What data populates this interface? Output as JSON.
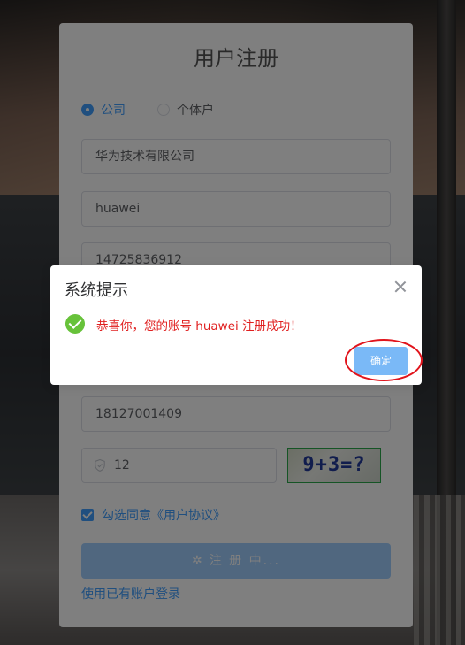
{
  "form": {
    "title": "用户注册",
    "type_options": [
      {
        "label": "公司",
        "checked": true
      },
      {
        "label": "个体户",
        "checked": false
      }
    ],
    "company_name": "华为技术有限公司",
    "username": "huawei",
    "phone": "14725836912",
    "mobile": "18127001409",
    "captcha_value": "12",
    "captcha_image_text": "9+3=?",
    "agreement_label": "勾选同意《用户协议》",
    "agreement_checked": true,
    "register_button": "注 册 中...",
    "login_link": "使用已有账户登录"
  },
  "dialog": {
    "title": "系统提示",
    "message": "恭喜你，您的账号 huawei 注册成功！",
    "ok_button": "确定"
  },
  "colors": {
    "primary": "#409eff",
    "success": "#67c23a",
    "message_text": "#e02020",
    "annotation": "#e1141c"
  }
}
